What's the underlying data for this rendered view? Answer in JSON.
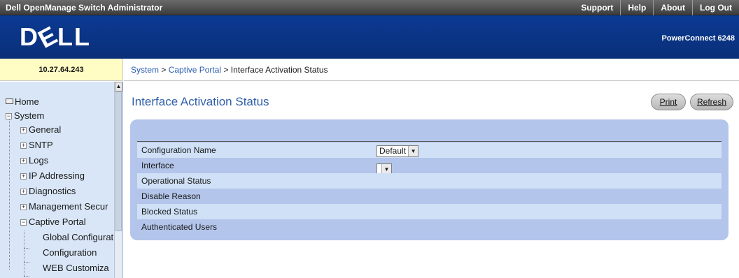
{
  "app_title": "Dell OpenManage Switch Administrator",
  "top_nav": [
    "Support",
    "Help",
    "About",
    "Log Out"
  ],
  "logo_text": "DELL",
  "product_name": "PowerConnect 6248",
  "ip_address": "10.27.64.243",
  "breadcrumb": {
    "items": [
      "System",
      "Captive Portal"
    ],
    "separator": ">",
    "current": "Interface Activation Status"
  },
  "sidebar": {
    "items": [
      {
        "label": "Home",
        "icon": "home-icon"
      },
      {
        "label": "System",
        "icon": "collapse-icon"
      },
      {
        "label": "General",
        "icon": "expand-icon"
      },
      {
        "label": "SNTP",
        "icon": "expand-icon"
      },
      {
        "label": "Logs",
        "icon": "expand-icon"
      },
      {
        "label": "IP Addressing",
        "icon": "expand-icon"
      },
      {
        "label": "Diagnostics",
        "icon": "expand-icon"
      },
      {
        "label": "Management Secur",
        "icon": "expand-icon"
      },
      {
        "label": "Captive Portal",
        "icon": "collapse-icon"
      },
      {
        "label": "Global Configurat",
        "icon": ""
      },
      {
        "label": "Configuration",
        "icon": ""
      },
      {
        "label": "WEB Customiza",
        "icon": ""
      }
    ]
  },
  "main": {
    "title": "Interface Activation Status",
    "buttons": {
      "print": "Print",
      "refresh": "Refresh"
    },
    "fields": [
      {
        "label": "Configuration Name",
        "value": "Default",
        "type": "select"
      },
      {
        "label": "Interface",
        "value": "",
        "type": "select"
      },
      {
        "label": "Operational Status",
        "value": ""
      },
      {
        "label": "Disable Reason",
        "value": ""
      },
      {
        "label": "Blocked Status",
        "value": ""
      },
      {
        "label": "Authenticated Users",
        "value": ""
      }
    ]
  },
  "colors": {
    "banner": "#0b3a93",
    "title": "#2f5fa8",
    "panel": "#b3c5ea",
    "panel_row_alt": "#cfe0f7",
    "sidebar": "#d9e6f7",
    "ip_box": "#fffcc4"
  }
}
